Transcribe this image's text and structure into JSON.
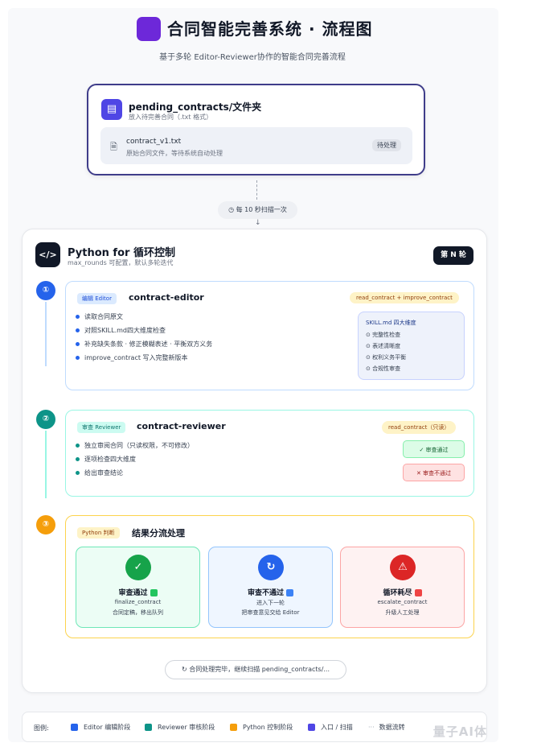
{
  "header": {
    "title": "合同智能完善系统 · 流程图",
    "subtitle": "基于多轮 Editor-Reviewer协作的智能合同完善流程"
  },
  "input_folder": {
    "title": "pending_contracts/文件夹",
    "subtitle": "放入待完善合同（.txt 格式）",
    "file_name": "contract_v1.txt",
    "file_desc": "原始合同文件，等待系统自动处理",
    "file_badge": "待处理"
  },
  "scan_pill": "每 10 秒扫描一次",
  "loop": {
    "title": "Python for 循环控制",
    "subtitle": "max_rounds 可配置，默认多轮迭代",
    "round_badge": "第 N 轮",
    "editor": {
      "tag": "编辑 Editor",
      "title": "contract-editor",
      "io": "read_contract + improve_contract",
      "bullets": [
        "读取合同原文",
        "对照SKILL.md四大维度检查",
        "补充缺失条款 · 修正模糊表述 · 平衡双方义务",
        "improve_contract 写入完整新版本"
      ],
      "skill": {
        "title": "SKILL.md 四大维度",
        "items": [
          "完整性检查",
          "表述清晰度",
          "权利义务平衡",
          "合规性审查"
        ]
      }
    },
    "reviewer": {
      "tag": "审查 Reviewer",
      "title": "contract-reviewer",
      "io": "read_contract（只读）",
      "bullets": [
        "独立审阅合同（只读权限，不可修改）",
        "逐项检查四大维度",
        "给出审查结论"
      ],
      "pass": "审查通过",
      "fail": "审查不通过"
    },
    "routing": {
      "tag": "Python 判断",
      "title": "结果分流处理",
      "outcomes": [
        {
          "title": "审查通过",
          "line1": "finalize_contract",
          "line2": "合同定稿，移出队列"
        },
        {
          "title": "审查不通过",
          "line1": "进入下一轮",
          "line2": "把审查意见交给 Editor"
        },
        {
          "title": "循环耗尽",
          "line1": "escalate_contract",
          "line2": "升级人工处理"
        }
      ]
    }
  },
  "continue_pill": "合同处理完毕，继续扫描 pending_contracts/...",
  "legend": {
    "label": "图例:",
    "items": [
      "Editor 编辑阶段",
      "Reviewer 审核阶段",
      "Python 控制阶段",
      "入口 / 扫描",
      "数据流转"
    ]
  },
  "watermark": "量子AI体",
  "colors": {
    "brand": "#6d28d9",
    "editor": "#2563eb",
    "reviewer": "#0d9488",
    "python": "#f59e0b",
    "entry": "#4f46e5",
    "fail": "#dc2626"
  }
}
